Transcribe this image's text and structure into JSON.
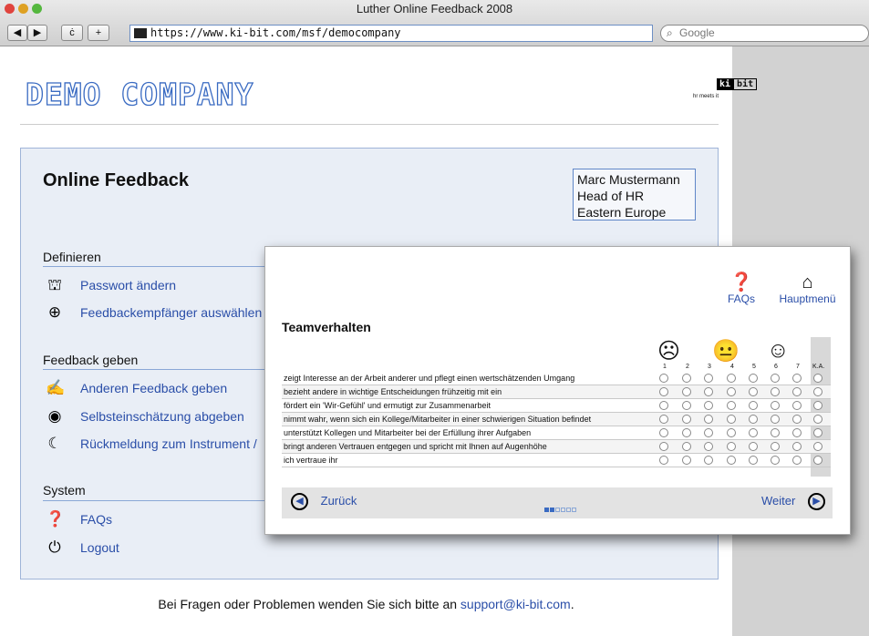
{
  "browser": {
    "window_title": "Luther Online Feedback 2008",
    "url": "https://www.ki-bit.com/msf/democompany",
    "search_placeholder": "Google",
    "buttons": {
      "back": "◀",
      "forward": "▶",
      "reload": "ċ",
      "add": "+"
    }
  },
  "header": {
    "logo": "DEMO COMPANY",
    "kibit_left": "ki",
    "kibit_right": "bit",
    "kibit_tagline": "hr meets it"
  },
  "main": {
    "title": "Online Feedback",
    "user": {
      "name": "Marc Mustermann",
      "role": "Head of HR",
      "region": "Eastern Europe"
    },
    "sections": {
      "define": {
        "label": "Definieren",
        "items": [
          {
            "label": "Passwort ändern",
            "icon": "lock-icon"
          },
          {
            "label": "Feedbackempfänger auswählen",
            "icon": "add-person-icon"
          }
        ]
      },
      "give": {
        "label": "Feedback geben",
        "items": [
          {
            "label": "Anderen Feedback geben",
            "icon": "edit-form-icon"
          },
          {
            "label": "Selbsteinschätzung abgeben",
            "icon": "self-target-icon"
          },
          {
            "label": "Rückmeldung zum Instrument / ",
            "icon": "speech-bubble-icon"
          }
        ]
      },
      "system": {
        "label": "System",
        "items": [
          {
            "label": "FAQs",
            "icon": "question-icon"
          },
          {
            "label": "Logout",
            "icon": "power-icon"
          }
        ]
      }
    }
  },
  "footer": {
    "text": "Bei Fragen oder Problemen wenden Sie sich bitte an ",
    "email": "support@ki-bit.com",
    "suffix": "."
  },
  "overlay": {
    "faqs": "FAQs",
    "home": "Hauptmenü",
    "section_title": "Teamverhalten",
    "scale": [
      "1",
      "2",
      "3",
      "4",
      "5",
      "6",
      "7",
      "K.A."
    ],
    "questions": [
      "zeigt Interesse an der Arbeit anderer und pflegt einen wertschätzenden Umgang",
      "bezieht andere in wichtige Entscheidungen frühzeitig mit ein",
      "fördert ein 'Wir-Gefühl' und ermutigt zur Zusammenarbeit",
      "nimmt wahr, wenn sich ein Kollege/Mitarbeiter in einer schwierigen Situation befindet",
      "unterstützt Kollegen und Mitarbeiter bei der Erfüllung ihrer Aufgaben",
      "bringt anderen Vertrauen entgegen und spricht mit Ihnen auf Augenhöhe",
      "ich vertraue ihr"
    ],
    "back": "Zurück",
    "next": "Weiter",
    "progress": {
      "current": 2,
      "total": 6
    }
  },
  "colors": {
    "accent": "#2a4ea8",
    "logo": "#3a6bc2",
    "panel": "#e9eef6"
  }
}
